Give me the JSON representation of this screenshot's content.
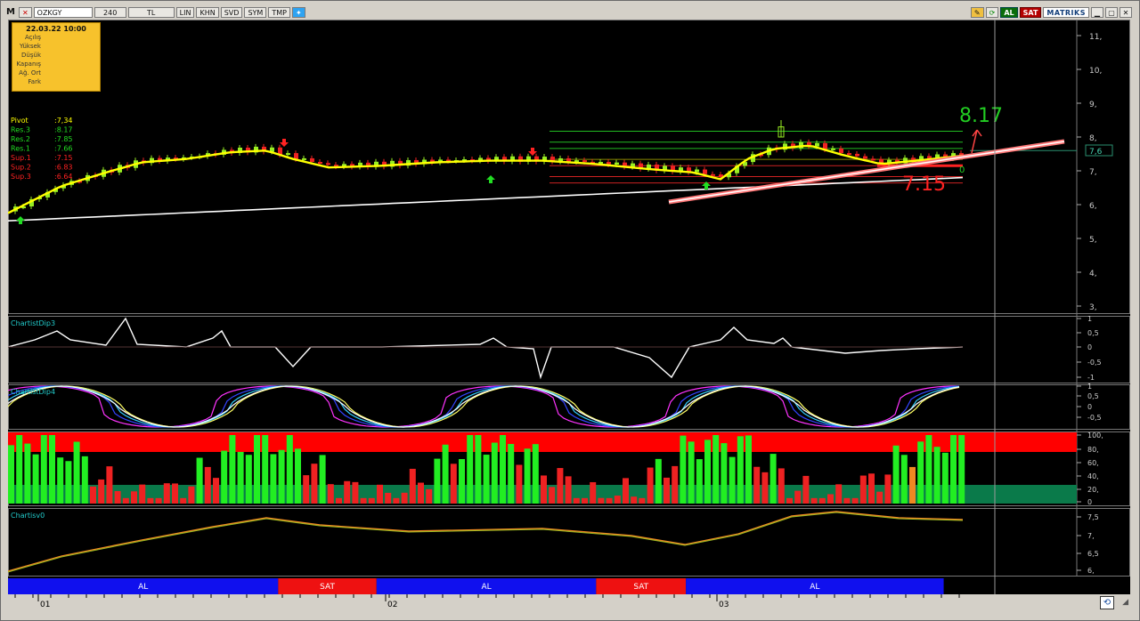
{
  "toolbar": {
    "logo": "M",
    "symbol": "OZKGY",
    "period": "240",
    "currency": "TL",
    "buttons": [
      "LIN",
      "KHN",
      "SVD",
      "SYM",
      "TMP"
    ],
    "buy_label": "AL",
    "sell_label": "SAT",
    "brand": "MATRIKS"
  },
  "info_box": {
    "date": "22.03.22 10:00",
    "rows": [
      "Açılış",
      "Yüksek",
      "Düşük",
      "Kapanış",
      "Ağ. Ort",
      "Fark"
    ]
  },
  "pivots": [
    {
      "label": "Pivot",
      "value": ":7,34",
      "color": "#ffff00"
    },
    {
      "label": "Res.3",
      "value": ":8.17",
      "color": "#22dd22"
    },
    {
      "label": "Res.2",
      "value": ":7.85",
      "color": "#22dd22"
    },
    {
      "label": "Res.1",
      "value": ":7.66",
      "color": "#22dd22"
    },
    {
      "label": "Sup.1",
      "value": ":7.15",
      "color": "#ff2222"
    },
    {
      "label": "Sup.2",
      "value": ":6.83",
      "color": "#ff2222"
    },
    {
      "label": "Sup.3",
      "value": ":6.64",
      "color": "#ff2222"
    }
  ],
  "annotations": {
    "target": "8.17",
    "support": "7.15",
    "last_price": "7,6",
    "marker_zero": "0"
  },
  "price_axis": {
    "labels": [
      "11,",
      "10,",
      "9,",
      "8,",
      "7,",
      "6,",
      "5,",
      "4,",
      "3,"
    ]
  },
  "panels": [
    {
      "name": "ChartistDip3",
      "axis": [
        "1",
        "0,5",
        "0",
        "-0,5",
        "-1"
      ]
    },
    {
      "name": "ChartistDip4",
      "axis": [
        "1",
        "0,5",
        "0",
        "-0,5"
      ]
    },
    {
      "name": "",
      "axis": [
        "100,",
        "80,",
        "60,",
        "40,",
        "20,",
        "0"
      ]
    },
    {
      "name": "Chartisv0",
      "axis": [
        "7,5",
        "7,",
        "6,5",
        "6,"
      ]
    }
  ],
  "signal_bar": [
    {
      "label": "AL",
      "color": "#1010ee",
      "from": 0,
      "to": 0.283
    },
    {
      "label": "SAT",
      "color": "#ee1111",
      "from": 0.283,
      "to": 0.386
    },
    {
      "label": "AL",
      "color": "#1010ee",
      "from": 0.386,
      "to": 0.616
    },
    {
      "label": "SAT",
      "color": "#ee1111",
      "from": 0.616,
      "to": 0.71
    },
    {
      "label": "AL",
      "color": "#1010ee",
      "from": 0.71,
      "to": 0.98
    }
  ],
  "time_axis": {
    "labels": [
      "01",
      "02",
      "03"
    ]
  },
  "colors": {
    "bull": "#99ee22",
    "bear": "#ee2222",
    "ma": "#ffff00",
    "grid": "#555555"
  }
}
